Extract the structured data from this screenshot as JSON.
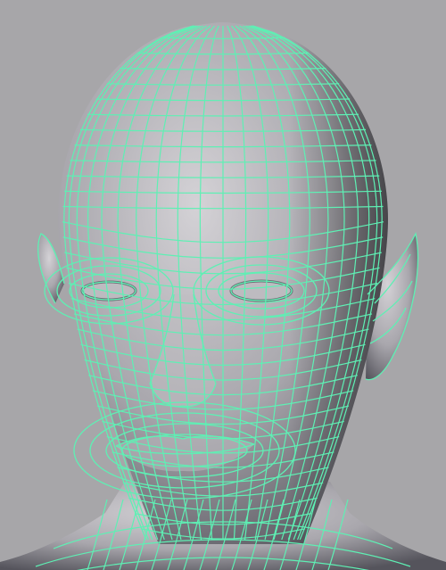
{
  "viewport": {
    "background_color": "#a7a6a9",
    "wire_color": "#5ef0b4",
    "skin_light": "#d4d2d6",
    "skin_mid": "#a9a7ad",
    "skin_dark": "#55545c",
    "eye_color": "#bdbbc0"
  },
  "model": {
    "shading_mode": "smooth-shaded-with-wireframe",
    "subject": "stylized-female-head-with-pointed-ears"
  }
}
